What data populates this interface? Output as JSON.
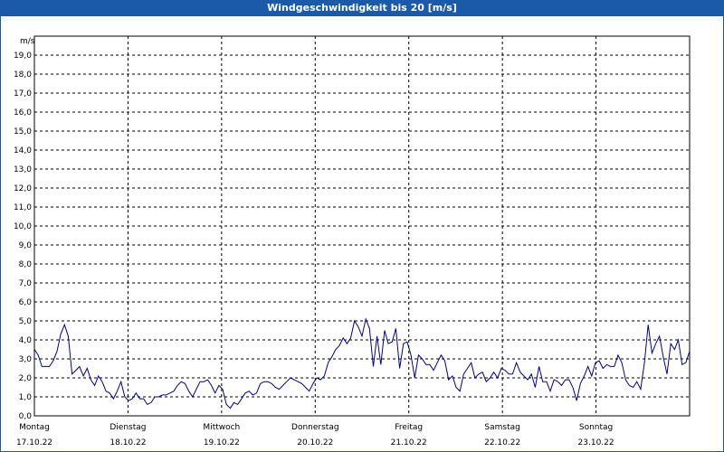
{
  "window": {
    "title": "Windgeschwindigkeit bis 20 [m/s]"
  },
  "chart_data": {
    "type": "line",
    "title": "Windgeschwindigkeit bis 20 [m/s]",
    "ylabel": "m/s",
    "ylim": [
      0,
      20
    ],
    "grid": true,
    "x_range_days": [
      0,
      7
    ],
    "y_ticks": [
      "0,0",
      "1,0",
      "2,0",
      "3,0",
      "4,0",
      "5,0",
      "6,0",
      "7,0",
      "8,0",
      "9,0",
      "10,0",
      "11,0",
      "12,0",
      "13,0",
      "14,0",
      "15,0",
      "16,0",
      "17,0",
      "18,0",
      "19,0"
    ],
    "x_ticks": [
      {
        "day": "Montag",
        "date": "17.10.22"
      },
      {
        "day": "Dienstag",
        "date": "18.10.22"
      },
      {
        "day": "Mittwoch",
        "date": "19.10.22"
      },
      {
        "day": "Donnerstag",
        "date": "20.10.22"
      },
      {
        "day": "Freitag",
        "date": "21.10.22"
      },
      {
        "day": "Samstag",
        "date": "22.10.22"
      },
      {
        "day": "Sonntag",
        "date": "23.10.22"
      }
    ],
    "line_color": "#00008b",
    "series": [
      {
        "values": [
          3.5,
          3.2,
          2.6,
          2.6,
          2.6,
          2.9,
          3.4,
          4.3,
          4.8,
          4.2,
          2.2,
          2.4,
          2.6,
          2.1,
          2.5,
          1.9,
          1.6,
          2.1,
          1.8,
          1.3,
          1.2,
          0.9,
          1.3,
          1.8,
          1.0,
          0.8,
          0.9,
          1.2,
          0.9,
          0.9,
          0.6,
          0.7,
          1.0,
          1.0,
          1.1,
          1.1,
          1.2,
          1.3,
          1.6,
          1.8,
          1.7,
          1.3,
          1.0,
          1.4,
          1.8,
          1.8,
          1.9,
          1.6,
          1.2,
          1.6,
          1.4,
          0.6,
          0.4,
          0.7,
          0.6,
          0.9,
          1.2,
          1.3,
          1.1,
          1.2,
          1.7,
          1.8,
          1.8,
          1.7,
          1.5,
          1.4,
          1.6,
          1.8,
          2.0,
          1.9,
          1.8,
          1.7,
          1.5,
          1.3,
          1.7,
          2.0,
          1.9,
          2.1,
          2.8,
          3.1,
          3.5,
          3.7,
          4.1,
          3.8,
          4.1,
          5.0,
          4.7,
          4.2,
          5.1,
          4.6,
          2.6,
          4.2,
          2.7,
          4.5,
          3.8,
          3.9,
          4.6,
          2.5,
          3.8,
          3.9,
          3.2,
          2.0,
          3.2,
          3.0,
          2.7,
          2.7,
          2.4,
          2.8,
          3.2,
          2.9,
          1.9,
          2.1,
          1.5,
          1.3,
          2.2,
          2.5,
          2.8,
          2.0,
          2.2,
          2.3,
          1.8,
          2.0,
          2.3,
          2.0,
          2.5,
          2.4,
          2.2,
          2.2,
          2.8,
          2.3,
          2.1,
          1.9,
          2.2,
          1.5,
          2.6,
          1.8,
          1.8,
          1.3,
          1.9,
          1.8,
          1.6,
          1.9,
          1.9,
          1.5,
          0.8,
          1.7,
          2.1,
          2.6,
          2.1,
          2.8,
          2.9,
          2.5,
          2.7,
          2.6,
          2.6,
          3.2,
          2.8,
          1.9,
          1.6,
          1.5,
          1.8,
          1.4,
          2.8,
          4.8,
          3.3,
          3.8,
          4.2,
          3.1,
          2.2,
          3.8,
          3.5,
          4.0,
          2.7,
          2.8,
          3.4
        ]
      }
    ]
  }
}
